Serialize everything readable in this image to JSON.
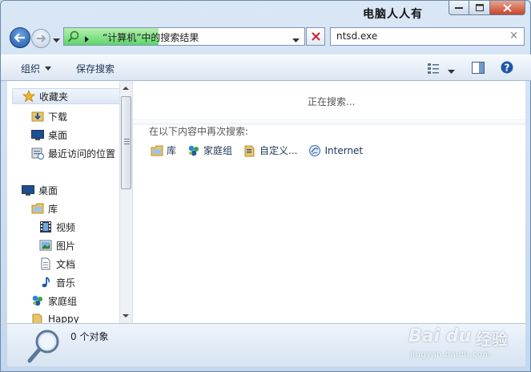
{
  "window": {
    "title": "电脑人人有"
  },
  "address": {
    "path": "“计算机”中的搜索结果"
  },
  "search": {
    "value": "ntsd.exe",
    "clear_glyph": "×"
  },
  "toolbar": {
    "organize": "组织",
    "save_search": "保存搜索"
  },
  "nav": {
    "favorites": "收藏夹",
    "downloads": "下载",
    "desktop_fav": "桌面",
    "recent": "最近访问的位置",
    "desktop": "桌面",
    "libraries": "库",
    "videos": "视频",
    "pictures": "图片",
    "documents": "文档",
    "music": "音乐",
    "homegroup": "家庭组",
    "happy": "Happy"
  },
  "content": {
    "searching": "正在搜索...",
    "search_again": "在以下内容中再次搜索:",
    "locations": [
      "库",
      "家庭组",
      "自定义...",
      "Internet"
    ]
  },
  "status": {
    "count": "0 个对象"
  },
  "watermark": {
    "brand": "Bai du",
    "jingyan": "经验",
    "url": "jingyan.baidu.com"
  },
  "colors": {
    "accent": "#1f57a8",
    "close": "#c7452a",
    "address_fill": "#5fd46c"
  }
}
